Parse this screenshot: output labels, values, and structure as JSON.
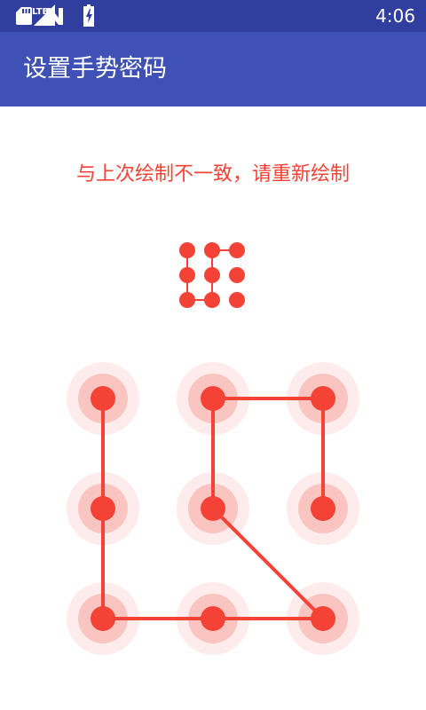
{
  "status_bar": {
    "time": "4:06",
    "network_label": "LTE",
    "icons": [
      "sd-card-icon",
      "n-notification-icon",
      "lte-signal-icon",
      "battery-charging-icon"
    ]
  },
  "toolbar": {
    "title": "设置手势密码"
  },
  "hint": {
    "message": "与上次绘制不一致，请重新绘制",
    "color": "#f44336"
  },
  "pattern_preview": {
    "path": [
      1,
      4,
      7,
      8,
      5,
      2,
      3
    ]
  },
  "pattern_grid": {
    "path": [
      1,
      4,
      7,
      8,
      9,
      5,
      2,
      3,
      6
    ],
    "selected": [
      1,
      2,
      3,
      4,
      5,
      6,
      7,
      8,
      9
    ],
    "error_color": "#f44336"
  },
  "colors": {
    "status_bar": "#303f9f",
    "toolbar": "#3f51b5",
    "error": "#f44336"
  }
}
